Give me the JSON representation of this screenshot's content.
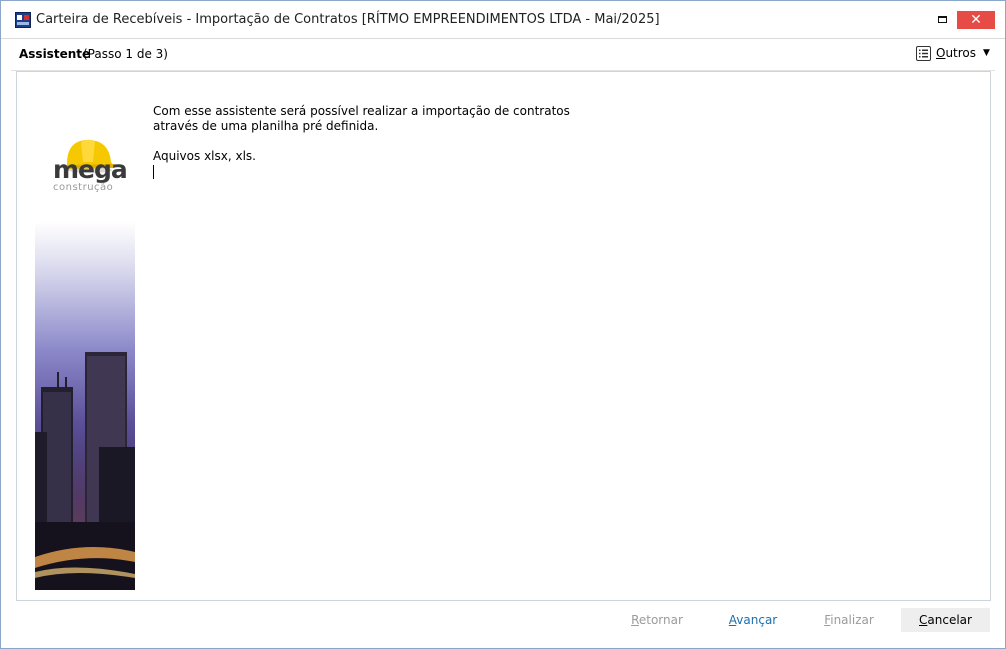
{
  "window": {
    "title": "Carteira de Recebíveis - Importação de Contratos [RÍTMO EMPREENDIMENTOS LTDA - Mai/2025]",
    "close_glyph": "✕"
  },
  "header": {
    "title": "Assistente",
    "step": "(Passo 1 de 3)",
    "outros_label": "Outros"
  },
  "branding": {
    "logo_text": "mega",
    "logo_subtext": "construção"
  },
  "content": {
    "intro_line1": "Com esse assistente será possível realizar a importação de contratos",
    "intro_line2": "através de uma planilha pré definida.",
    "formats": "Aquivos xlsx, xls."
  },
  "footer": {
    "retornar": "Retornar",
    "avancar": "Avançar",
    "finalizar": "Finalizar",
    "cancelar": "Cancelar"
  },
  "colors": {
    "accent": "#1b6fae",
    "close": "#e64b45",
    "disabled": "#9b9b9b",
    "helmet": "#f5c800"
  },
  "icons": [
    "app-icon",
    "maximize-icon",
    "close-icon",
    "list-icon",
    "chevron-down-icon",
    "helmet-icon"
  ]
}
